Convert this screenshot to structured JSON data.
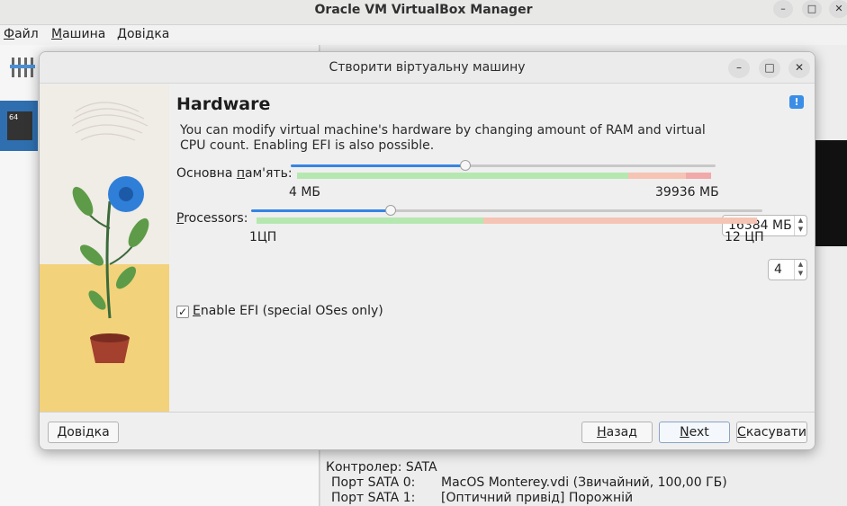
{
  "main_window": {
    "title": "Oracle VM VirtualBox Manager",
    "controls": {
      "minimize": "–",
      "maximize": "□",
      "close": "✕"
    },
    "menu": [
      {
        "underlined": "Ф",
        "rest": "айл"
      },
      {
        "underlined": "М",
        "rest": "ашина"
      },
      {
        "underlined": "Д",
        "rest": "овідка"
      }
    ],
    "vm_badge": "64",
    "storage": {
      "controller": "Контролер: SATA",
      "rows": [
        {
          "port": "Порт SATA 0:",
          "value": "MacOS Monterey.vdi (Звичайний, 100,00 ГБ)"
        },
        {
          "port": "Порт SATA 1:",
          "value": "[Оптичний привід] Порожній"
        }
      ]
    }
  },
  "dialog": {
    "title": "Створити віртуальну машину",
    "controls": {
      "minimize": "–",
      "maximize": "□",
      "close": "✕"
    },
    "heading": "Hardware",
    "description": "You can modify virtual machine's hardware by changing amount of RAM and virtual CPU count. Enabling EFI is also possible.",
    "memory": {
      "label_pre": "Основна ",
      "label_underlined": "п",
      "label_post": "ам'ять:",
      "value": "16384 МБ",
      "value_mb": 16384,
      "min_label": "4 МБ",
      "max_label": "39936 МБ",
      "min_mb": 4,
      "max_mb": 39936
    },
    "processors": {
      "label_underlined": "P",
      "label_post": "rocessors:",
      "value": "4",
      "count": 4,
      "min_label": "1ЦП",
      "max_label": "12 ЦП",
      "min": 1,
      "max": 12
    },
    "efi": {
      "underlined": "E",
      "rest": "nable EFI (special OSes only)",
      "checked": true,
      "check_mark": "✓"
    },
    "buttons": {
      "help": {
        "underlined": "Д",
        "rest": "овідка"
      },
      "back": {
        "underlined": "Н",
        "rest": "азад"
      },
      "next": {
        "underlined": "N",
        "rest": "ext"
      },
      "cancel": {
        "underlined": "С",
        "rest": "касувати"
      }
    }
  },
  "colors": {
    "accent": "#3584e4",
    "safe_zone": "#b5e8b0",
    "warn_zone": "#f5c4b4",
    "danger_zone": "#f2a9a9",
    "floor": "#f2d27a",
    "flower": "#2f7fd8",
    "pot": "#a3402e"
  },
  "icons": {
    "help": "help-bubble-icon",
    "tools": "tools-icon",
    "vm": "os-x-icon"
  }
}
